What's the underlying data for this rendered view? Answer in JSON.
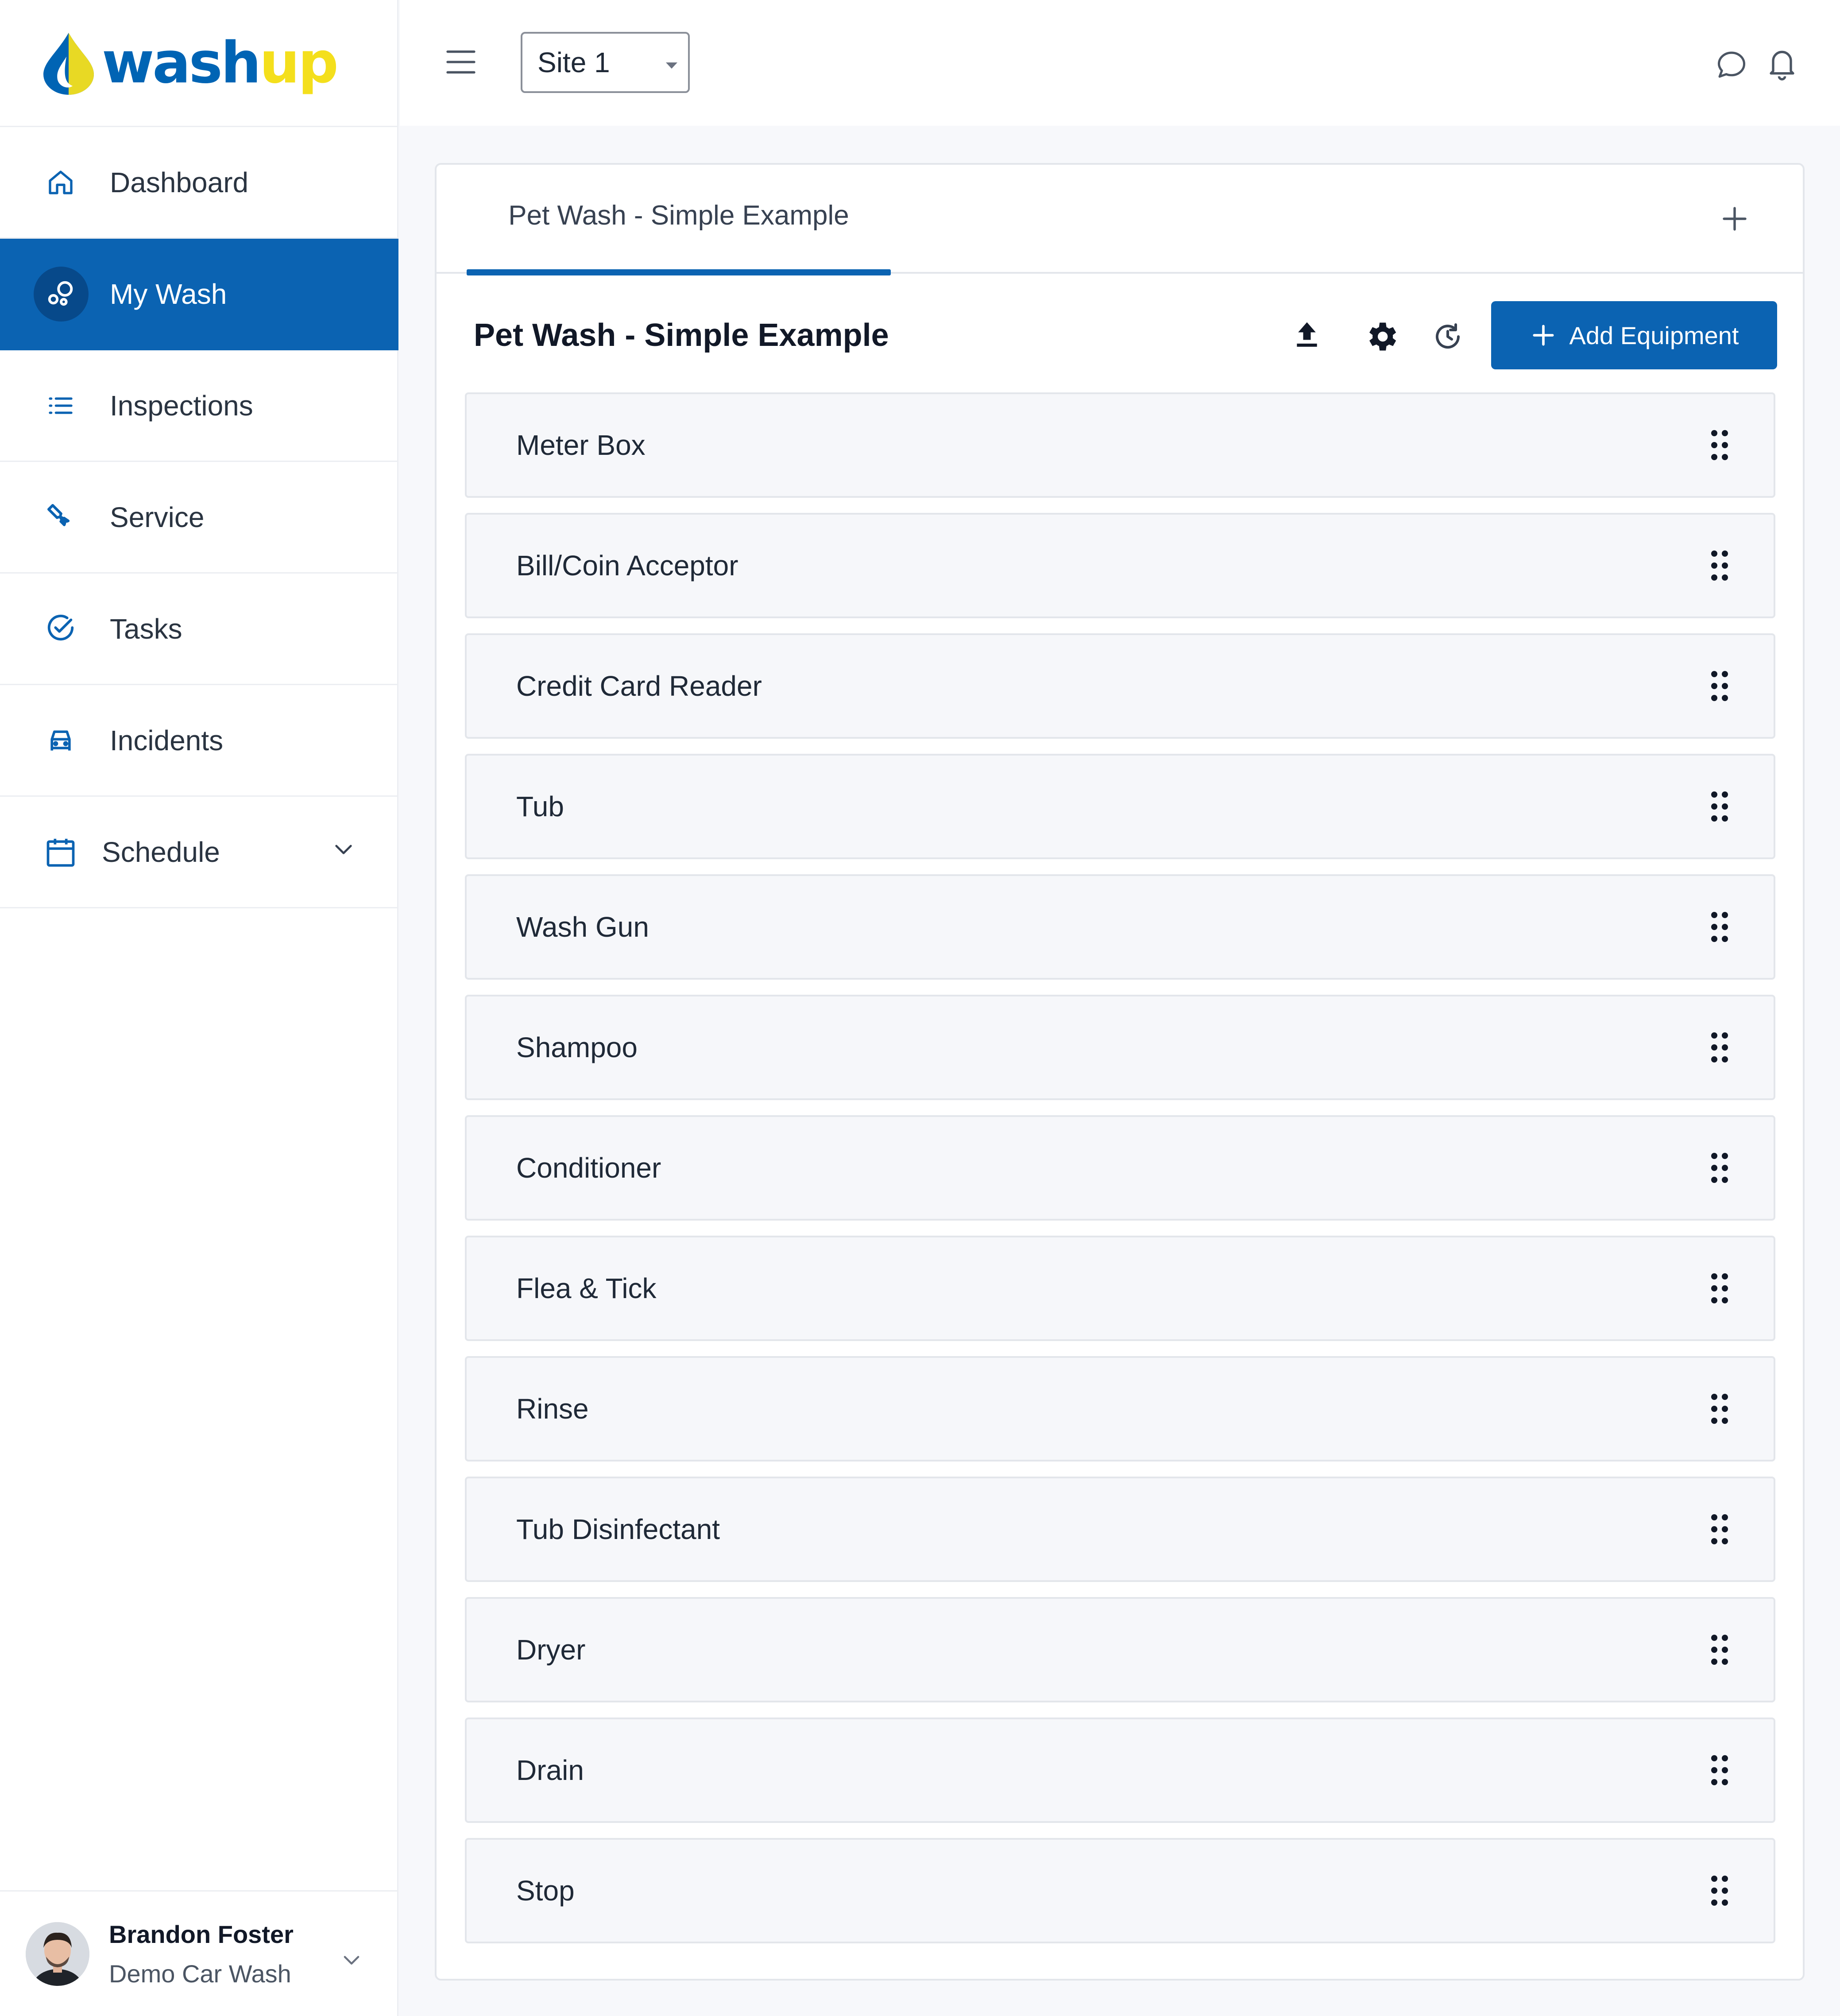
{
  "brand": {
    "logo_part1": "wash",
    "logo_part2": "up",
    "primary": "#0b63b2",
    "accent": "#f4df1c"
  },
  "sidebar": {
    "items": [
      {
        "label": "Dashboard",
        "icon": "home-icon"
      },
      {
        "label": "My Wash",
        "icon": "bubbles-icon",
        "active": true
      },
      {
        "label": "Inspections",
        "icon": "list-icon"
      },
      {
        "label": "Service",
        "icon": "wrench-icon"
      },
      {
        "label": "Tasks",
        "icon": "check-circle-icon"
      },
      {
        "label": "Incidents",
        "icon": "car-icon"
      },
      {
        "label": "Schedule",
        "icon": "calendar-icon",
        "expandable": true
      }
    ]
  },
  "user": {
    "name": "Brandon Foster",
    "organization": "Demo Car Wash"
  },
  "topbar": {
    "site_selected": "Site 1"
  },
  "tabs": [
    {
      "label": "Pet Wash - Simple Example",
      "active": true
    }
  ],
  "section": {
    "title": "Pet Wash - Simple Example",
    "add_button_label": "Add Equipment"
  },
  "equipment": [
    "Meter Box",
    "Bill/Coin Acceptor",
    "Credit Card Reader",
    "Tub",
    "Wash Gun",
    "Shampoo",
    "Conditioner",
    "Flea & Tick",
    "Rinse",
    "Tub Disinfectant",
    "Dryer",
    "Drain",
    "Stop"
  ]
}
